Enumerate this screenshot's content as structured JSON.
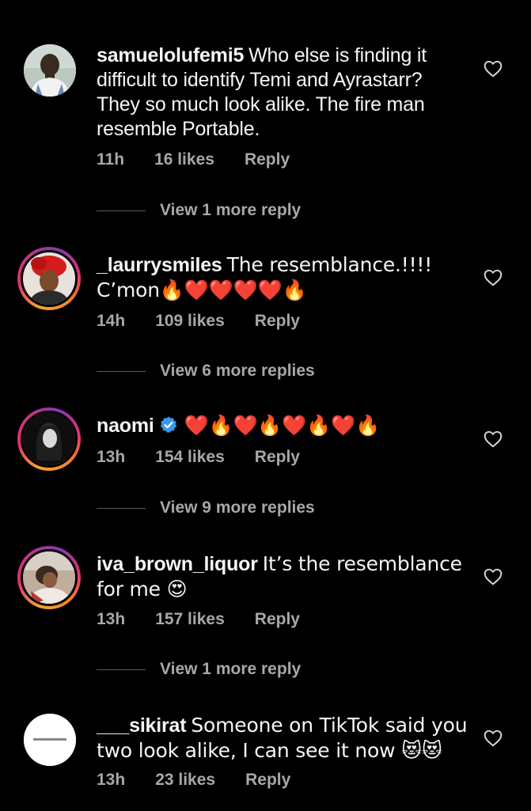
{
  "comments": [
    {
      "username": "samuelolufemi5",
      "text": "Who else is finding it difficult to identify Temi and Ayrastarr? They so much look alike. The fire man resemble Portable.",
      "time": "11h",
      "likes": "16 likes",
      "reply_label": "Reply",
      "view_replies": "View 1 more reply"
    },
    {
      "username": "_laurrysmiles",
      "text": "The resemblance.!!!! C’mon🔥❤️❤️❤️❤️🔥",
      "time": "14h",
      "likes": "109 likes",
      "reply_label": "Reply",
      "view_replies": "View 6 more replies"
    },
    {
      "username": "naomi",
      "text": "❤️🔥❤️🔥❤️🔥❤️🔥",
      "time": "13h",
      "likes": "154 likes",
      "reply_label": "Reply",
      "view_replies": "View 9 more replies"
    },
    {
      "username": "iva_brown_liquor",
      "text": "It’s the resemblance for me 😍",
      "time": "13h",
      "likes": "157 likes",
      "reply_label": "Reply",
      "view_replies": "View 1 more reply"
    },
    {
      "username": "___sikirat",
      "text": "Someone on TikTok said you two look alike, I can see it now 😻😻",
      "time": "13h",
      "likes": "23 likes",
      "reply_label": "Reply"
    }
  ],
  "icons": {
    "like": "heart-outline-icon",
    "verified": "verified-badge-icon"
  },
  "colors": {
    "background": "#000000",
    "text": "#f5f5f5",
    "muted": "#a8a8a8",
    "verified": "#3897f0"
  }
}
